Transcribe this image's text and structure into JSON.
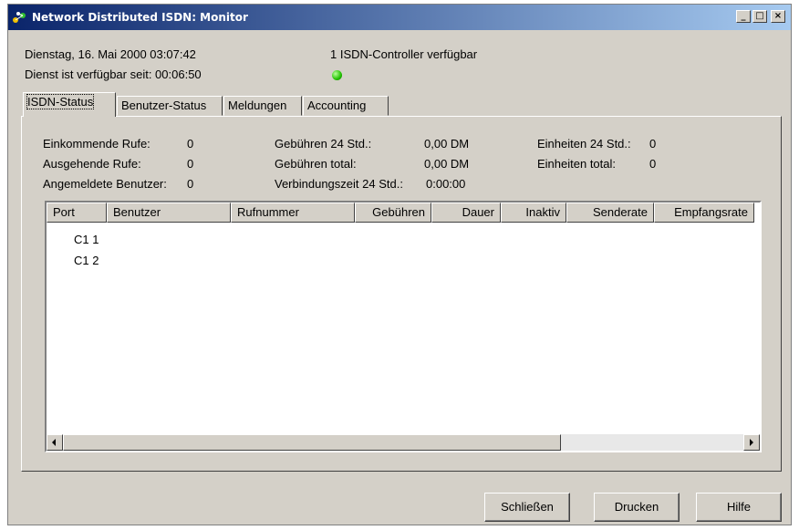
{
  "window": {
    "title": "Network Distributed ISDN: Monitor",
    "minimize": "_",
    "maximize": "□",
    "close": "×"
  },
  "info": {
    "datetime": "Dienstag, 16. Mai 2000  03:07:42",
    "uptime": "Dienst ist verfügbar seit: 00:06:50",
    "controller": "1 ISDN-Controller verfügbar",
    "led_color": "#22c000"
  },
  "tabs": [
    {
      "label": "ISDN-Status",
      "active": true
    },
    {
      "label": "Benutzer-Status",
      "active": false
    },
    {
      "label": "Meldungen",
      "active": false
    },
    {
      "label": "Accounting",
      "active": false
    }
  ],
  "stats": {
    "incoming_label": "Einkommende Rufe:",
    "incoming_value": "0",
    "outgoing_label": "Ausgehende Rufe:",
    "outgoing_value": "0",
    "users_label": "Angemeldete Benutzer:",
    "users_value": "0",
    "fees24_label": "Gebühren 24 Std.:",
    "fees24_value": "0,00 DM",
    "fees_total_label": "Gebühren total:",
    "fees_total_value": "0,00 DM",
    "conn_label": "Verbindungszeit 24 Std.:",
    "conn_value": "0:00:00",
    "units24_label": "Einheiten 24 Std.:",
    "units24_value": "0",
    "units_total_label": "Einheiten total:",
    "units_total_value": "0"
  },
  "table": {
    "columns": [
      "Port",
      "Benutzer",
      "Rufnummer",
      "Gebühren",
      "Dauer",
      "Inaktiv",
      "Senderate",
      "Empfangsrate"
    ],
    "rows": [
      "C1 1",
      "C1 2"
    ]
  },
  "buttons": {
    "close": "Schließen",
    "print": "Drucken",
    "help": "Hilfe"
  }
}
